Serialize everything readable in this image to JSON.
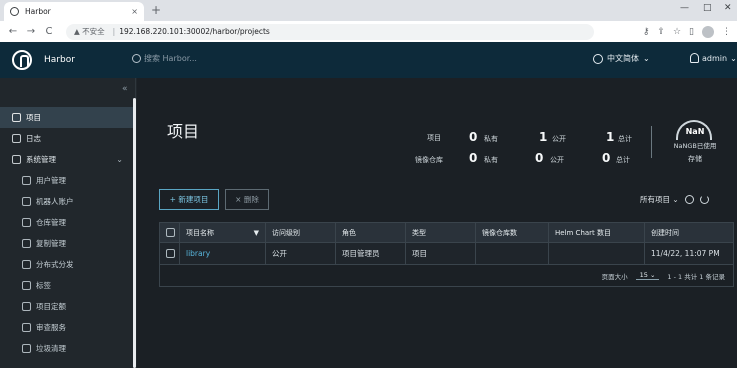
{
  "browser": {
    "tab_title": "Harbor",
    "tab_close": "×",
    "new_tab": "+",
    "win_min": "—",
    "win_max": "□",
    "win_close": "✕",
    "nav_back": "←",
    "nav_forward": "→",
    "nav_reload": "C",
    "security_label": "▲ 不安全",
    "url": "192.168.220.101:30002/harbor/projects"
  },
  "header": {
    "brand": "Harbor",
    "search_placeholder": "搜索 Harbor...",
    "language": "中文简体",
    "user": "admin"
  },
  "sidebar": {
    "collapse": "«",
    "items": [
      {
        "label": "项目"
      },
      {
        "label": "日志"
      },
      {
        "label": "系统管理"
      },
      {
        "label": "用户管理"
      },
      {
        "label": "机器人账户"
      },
      {
        "label": "仓库管理"
      },
      {
        "label": "复制管理"
      },
      {
        "label": "分布式分发"
      },
      {
        "label": "标签"
      },
      {
        "label": "项目定额"
      },
      {
        "label": "审查服务"
      },
      {
        "label": "垃圾清理"
      }
    ]
  },
  "page": {
    "title": "项目",
    "stats": {
      "project_label": "项目",
      "repo_label": "镜像仓库",
      "private_project_num": "0",
      "private_project_label": "私有",
      "public_project_num": "1",
      "public_project_label": "公开",
      "total_project_num": "1",
      "total_project_label": "总计",
      "private_repo_num": "0",
      "private_repo_label": "私有",
      "public_repo_num": "0",
      "public_repo_label": "公开",
      "total_repo_num": "0",
      "total_repo_label": "总计"
    },
    "quota": {
      "gauge": "NaN",
      "used": "NaNGB已使用",
      "storage": "存储"
    },
    "toolbar": {
      "new_project": "+ 新建项目",
      "delete": "× 删除",
      "filter": "所有项目 ⌄"
    },
    "table": {
      "columns": [
        "项目名称",
        "访问级别",
        "角色",
        "类型",
        "镜像仓库数",
        "Helm Chart 数目",
        "创建时间"
      ],
      "rows": [
        {
          "name": "library",
          "access": "公开",
          "role": "项目管理员",
          "type": "项目",
          "repos": "",
          "charts": "",
          "created": "11/4/22, 11:07 PM"
        }
      ],
      "page_size_label": "页面大小",
      "page_size": "15",
      "summary": "1 - 1 共计 1 条记录"
    }
  }
}
